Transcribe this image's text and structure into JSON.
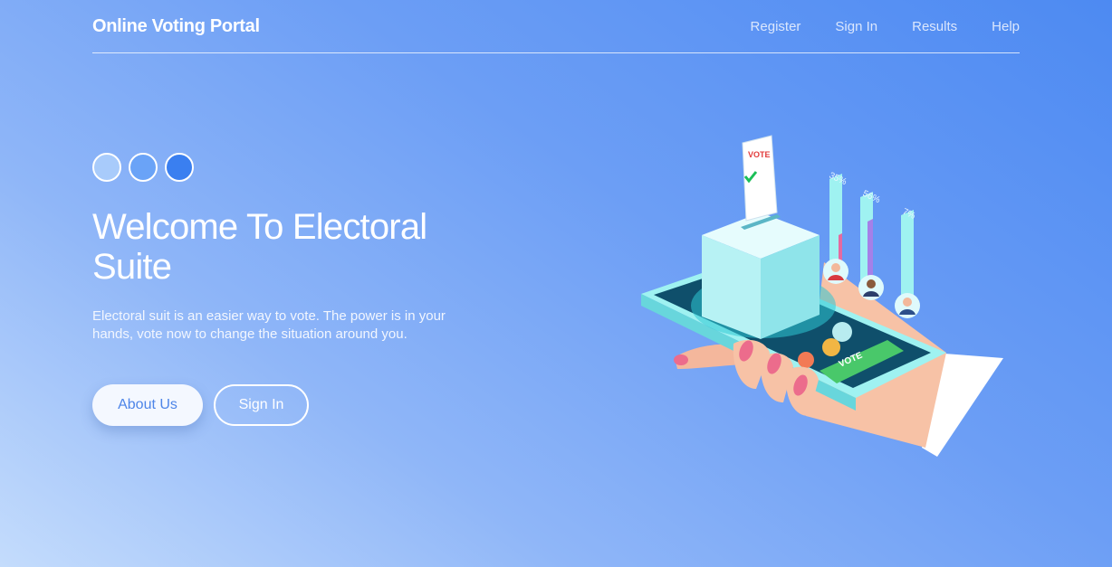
{
  "header": {
    "brand": "Online Voting Portal",
    "nav": [
      "Register",
      "Sign In",
      "Results",
      "Help"
    ]
  },
  "hero": {
    "title": "Welcome To Electoral Suite",
    "description": "Electoral suit is an easier way to vote. The power is in your hands, vote now to change the situation around you.",
    "buttons": {
      "about": "About Us",
      "signin": "Sign In"
    }
  },
  "illustration": {
    "ballot_label": "VOTE",
    "vote_button": "VOTE",
    "percentages": [
      "35%",
      "56%",
      "7%"
    ]
  },
  "colors": {
    "accent": "#4d85e8",
    "dot_light": "#a8cbfb",
    "dot_mid": "#6aa3f7",
    "dot_dark": "#3a7ff0"
  }
}
